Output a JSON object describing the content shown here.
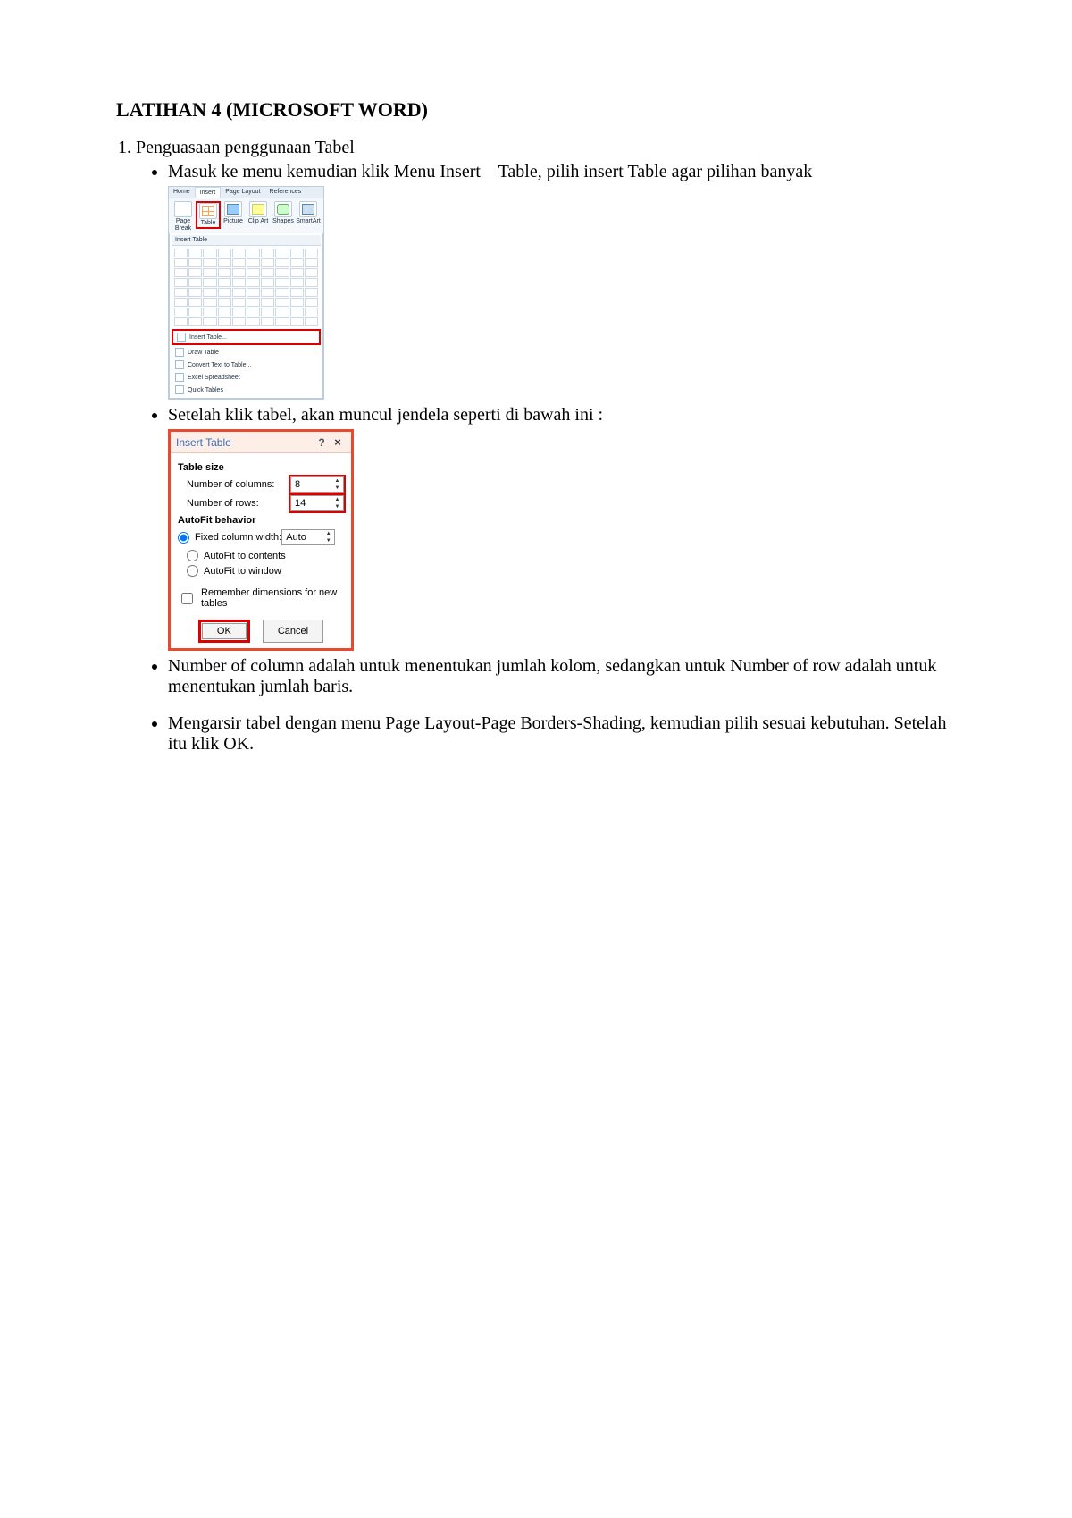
{
  "title": "LATIHAN 4 (MICROSOFT WORD)",
  "list1_item": "Penguasaan penggunaan Tabel",
  "bullets": {
    "b1": "Masuk ke menu kemudian klik Menu Insert – Table, pilih insert Table agar pilihan banyak",
    "b2": "Setelah klik tabel, akan muncul jendela seperti di bawah ini :",
    "b3": "Number of column adalah untuk menentukan jumlah kolom, sedangkan untuk Number of row adalah untuk menentukan jumlah baris.",
    "b4": "Mengarsir tabel dengan menu Page Layout-Page Borders-Shading, kemudian pilih sesuai kebutuhan. Setelah itu klik OK."
  },
  "ribbon": {
    "tabs": {
      "home": "Home",
      "insert": "Insert",
      "pagelayout": "Page Layout",
      "references": "References"
    },
    "page_break": "Page Break",
    "buttons": {
      "table": "Table",
      "picture": "Picture",
      "clip": "Clip Art",
      "shapes": "Shapes",
      "smartart": "SmartArt"
    },
    "dd_title": "Insert Table",
    "dd_items": {
      "insert_table": "Insert Table...",
      "draw_table": "Draw Table",
      "convert": "Convert Text to Table...",
      "excel": "Excel Spreadsheet",
      "quick": "Quick Tables"
    }
  },
  "dialog": {
    "title": "Insert Table",
    "q": "?",
    "x": "×",
    "table_size": "Table size",
    "cols_label": "Number of columns:",
    "cols_value": "8",
    "rows_label": "Number of rows:",
    "rows_value": "14",
    "autofit_hdr": "AutoFit behavior",
    "fixed": "Fixed column width:",
    "fixed_val": "Auto",
    "autofit_contents": "AutoFit to contents",
    "autofit_window": "AutoFit to window",
    "remember": "Remember dimensions for new tables",
    "ok": "OK",
    "cancel": "Cancel"
  }
}
